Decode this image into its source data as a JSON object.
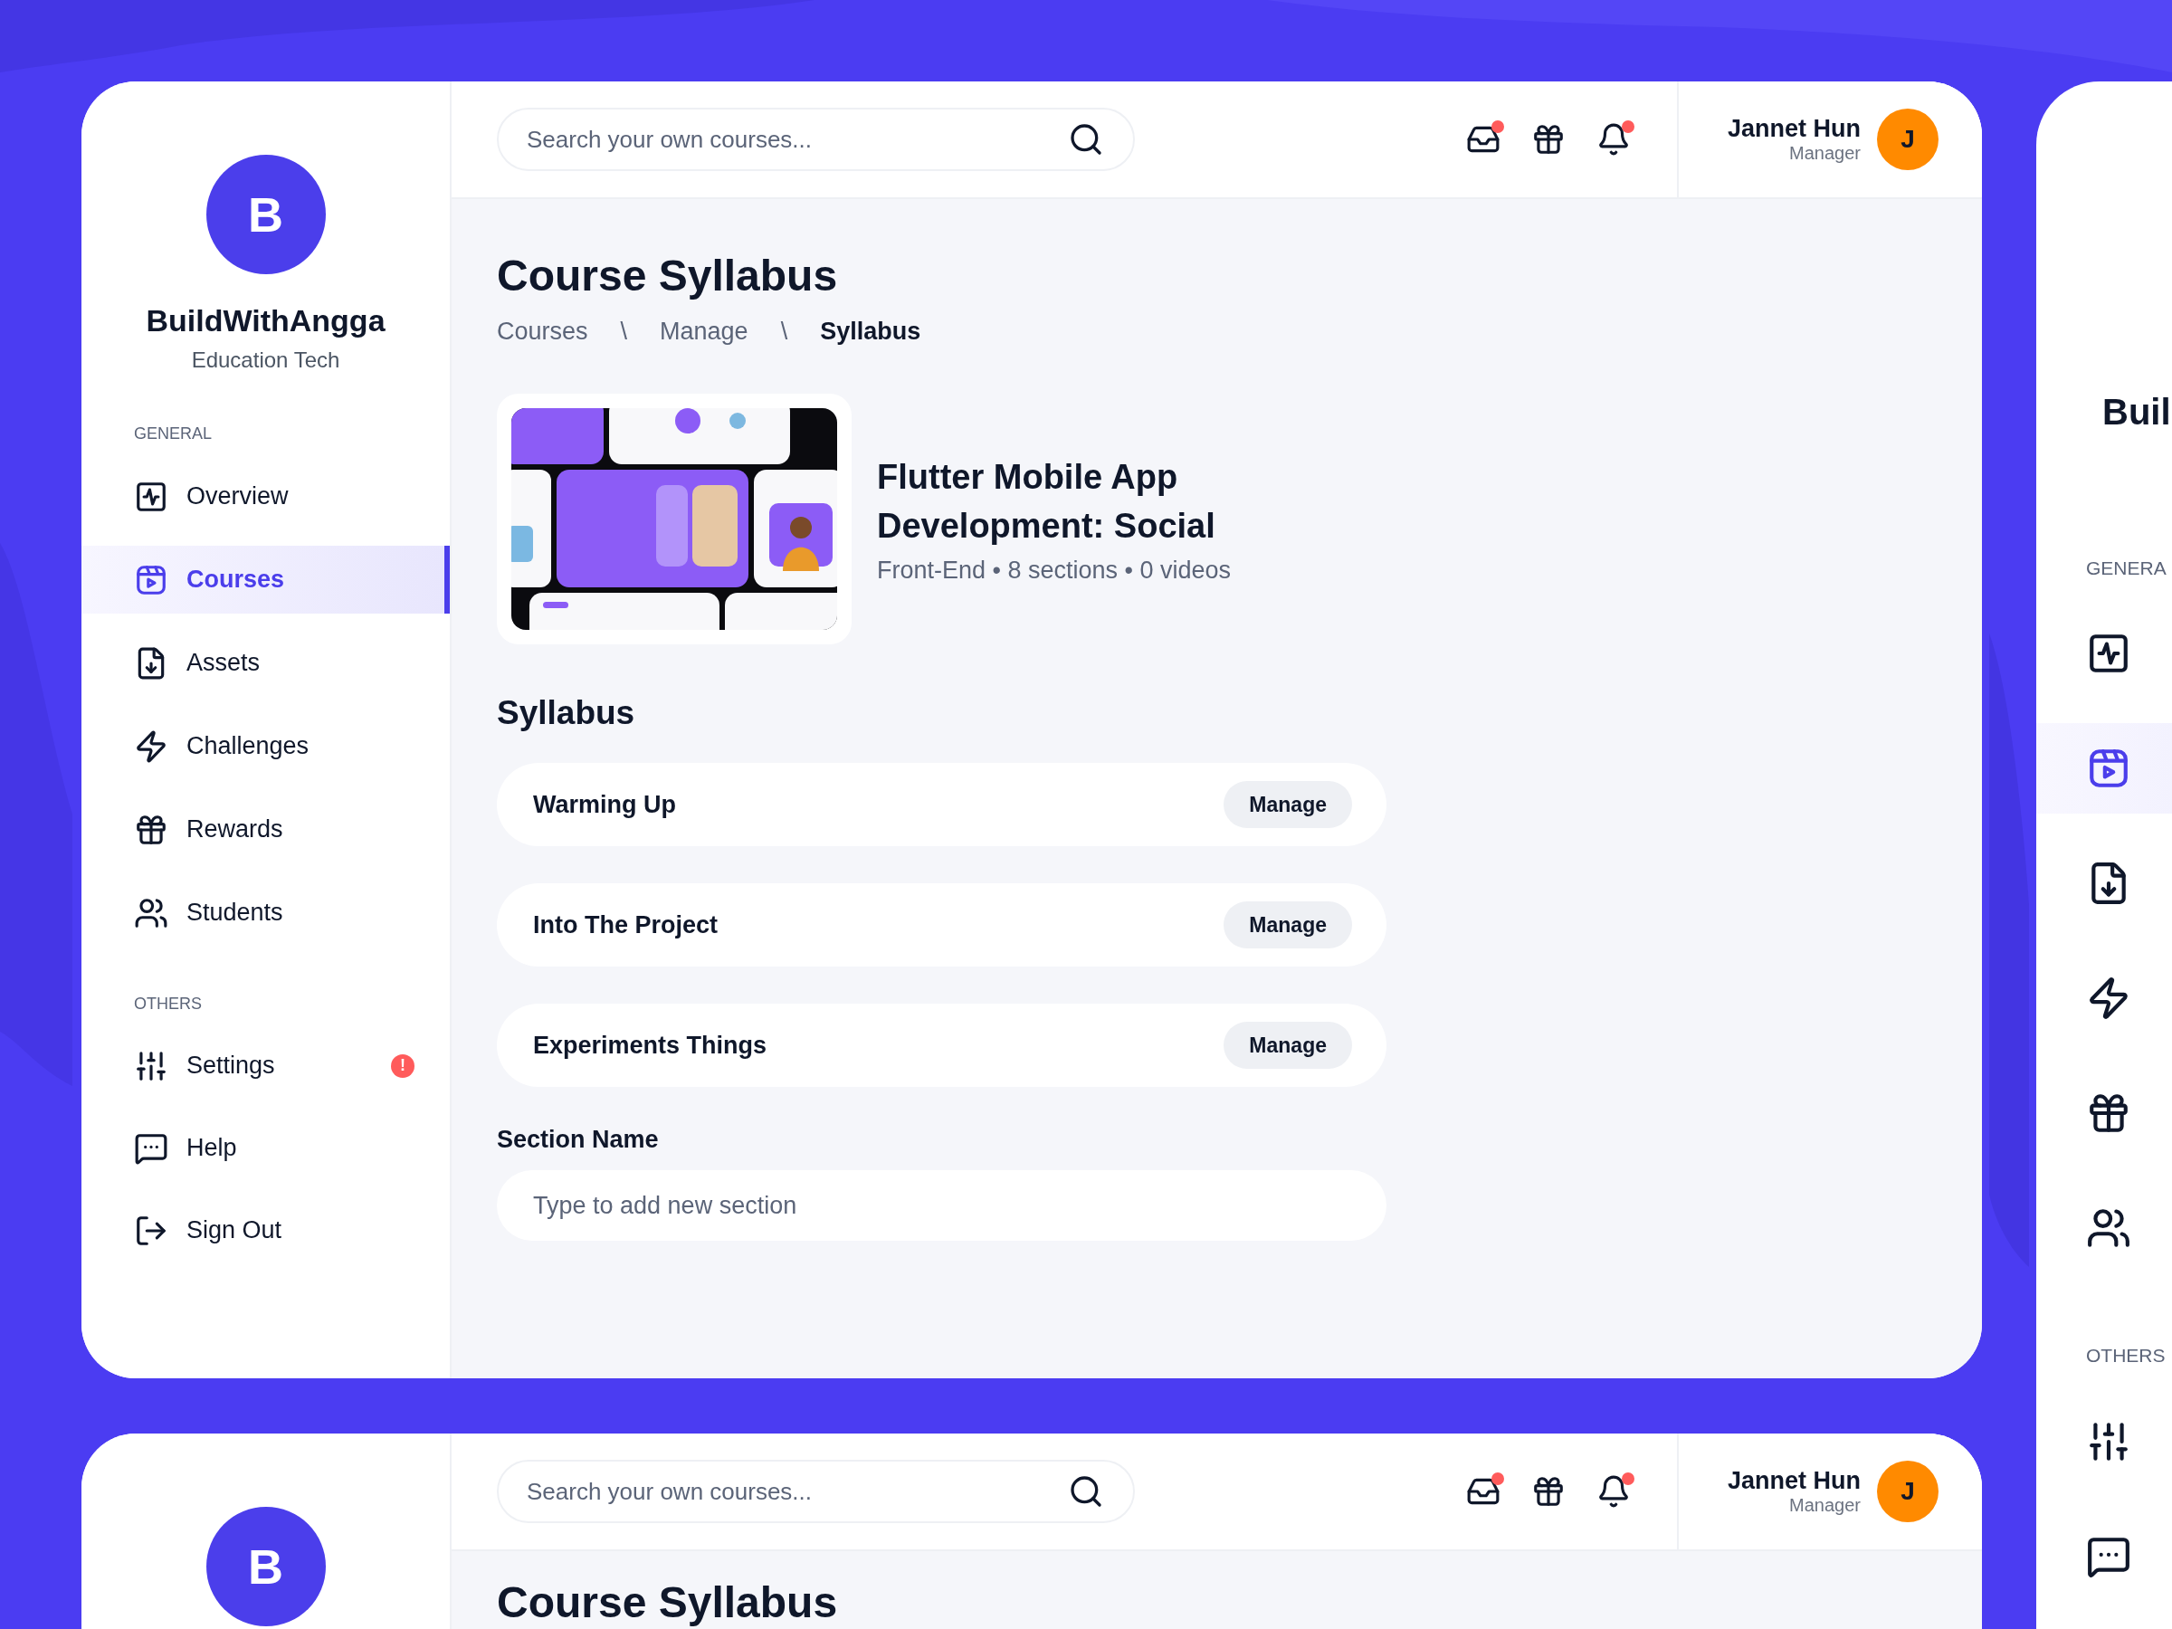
{
  "main_card": {
    "brand": {
      "initial": "B",
      "name": "BuildWithAngga",
      "tagline": "Education Tech"
    },
    "sidebar": {
      "sections": [
        {
          "title": "GENERAL",
          "items": [
            {
              "label": "Overview",
              "selected": false
            },
            {
              "label": "Courses",
              "selected": true
            },
            {
              "label": "Assets",
              "selected": false
            },
            {
              "label": "Challenges",
              "selected": false
            },
            {
              "label": "Rewards",
              "selected": false
            },
            {
              "label": "Students",
              "selected": false
            }
          ]
        },
        {
          "title": "OTHERS",
          "items": [
            {
              "label": "Settings",
              "selected": false,
              "badge": "!"
            },
            {
              "label": "Help",
              "selected": false
            },
            {
              "label": "Sign Out",
              "selected": false
            }
          ]
        }
      ]
    },
    "header": {
      "search_placeholder": "Search your own courses...",
      "icons": [
        {
          "dot": true
        },
        {
          "dot": false
        },
        {
          "dot": true
        }
      ],
      "user": {
        "name": "Jannet Hun",
        "role": "Manager",
        "initial": "J"
      }
    },
    "page": {
      "title": "Course Syllabus",
      "breadcrumb": [
        {
          "label": "Courses",
          "selected": false
        },
        {
          "label": "Manage",
          "selected": false
        },
        {
          "label": "Syllabus",
          "selected": true
        }
      ],
      "breadcrumb_separators": [
        "\\",
        "\\"
      ],
      "course": {
        "title": "Flutter Mobile App Development: Social",
        "meta": "Front-End • 8 sections • 0 videos"
      },
      "syllabus": {
        "title": "Syllabus",
        "sections": [
          {
            "name": "Warming Up",
            "action": "Manage"
          },
          {
            "name": "Into The Project",
            "action": "Manage"
          },
          {
            "name": "Experiments Things",
            "action": "Manage"
          }
        ]
      },
      "new_section": {
        "label": "Section Name",
        "placeholder": "Type to add new section"
      }
    }
  },
  "bottom_card": {
    "brand": {
      "initial": "B"
    },
    "header": {
      "search_placeholder": "Search your own courses...",
      "icons": [
        {
          "dot": true
        },
        {
          "dot": false
        },
        {
          "dot": true
        }
      ],
      "user": {
        "name": "Jannet Hun",
        "role": "Manager",
        "initial": "J"
      }
    },
    "title": "Course Syllabus"
  },
  "right_card": {
    "brand_name": "Buil",
    "sections": [
      {
        "title": "GENERA",
        "items": [
          {
            "selected": false
          },
          {
            "selected": true
          },
          {
            "selected": false
          },
          {
            "selected": false
          },
          {
            "selected": false
          },
          {
            "selected": false
          }
        ]
      },
      {
        "title": "OTHERS",
        "items": [
          {
            "selected": false
          },
          {
            "selected": false
          }
        ]
      }
    ]
  }
}
